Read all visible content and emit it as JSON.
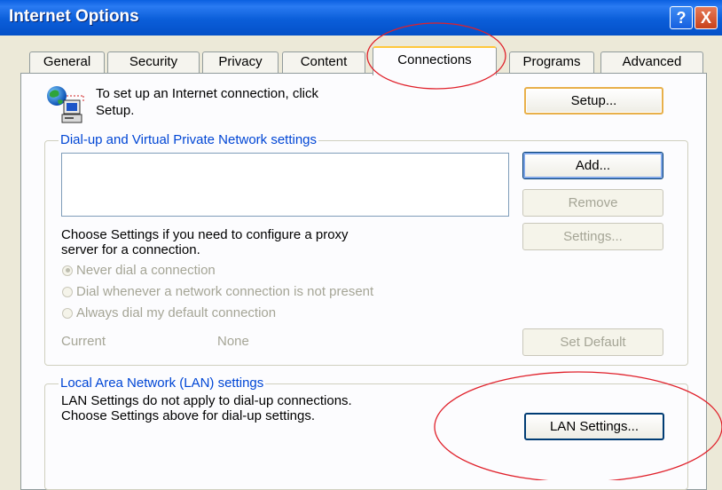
{
  "window": {
    "title": "Internet Options",
    "help_label": "?",
    "close_label": "X"
  },
  "tabs": [
    {
      "label": "General"
    },
    {
      "label": "Security"
    },
    {
      "label": "Privacy"
    },
    {
      "label": "Content"
    },
    {
      "label": "Connections",
      "active": true
    },
    {
      "label": "Programs"
    },
    {
      "label": "Advanced"
    }
  ],
  "setup": {
    "text_line1": "To set up an Internet connection, click",
    "text_line2": "Setup.",
    "button_label": "Setup..."
  },
  "dialup": {
    "group_title": "Dial-up and Virtual Private Network settings",
    "add_label": "Add...",
    "remove_label": "Remove",
    "settings_label": "Settings...",
    "proxy_text_line1": "Choose Settings if you need to configure a proxy",
    "proxy_text_line2": "server for a connection.",
    "radios": [
      {
        "label": "Never dial a connection",
        "selected": true
      },
      {
        "label": "Dial whenever a network connection is not present",
        "selected": false
      },
      {
        "label": "Always dial my default connection",
        "selected": false
      }
    ],
    "current_label": "Current",
    "current_value": "None",
    "set_default_label": "Set Default"
  },
  "lan": {
    "group_title": "Local Area Network (LAN) settings",
    "text_line1": "LAN Settings do not apply to dial-up connections.",
    "text_line2": "Choose Settings above for dial-up settings.",
    "button_label": "LAN Settings..."
  },
  "colors": {
    "titlebar": "#0A5FE0",
    "group_title": "#0046D5",
    "annotation": "#E0202A",
    "dialog_bg": "#ECE9D8"
  },
  "icons": {
    "setup": "network-computer-globe-icon",
    "help": "question-icon",
    "close": "close-icon"
  }
}
